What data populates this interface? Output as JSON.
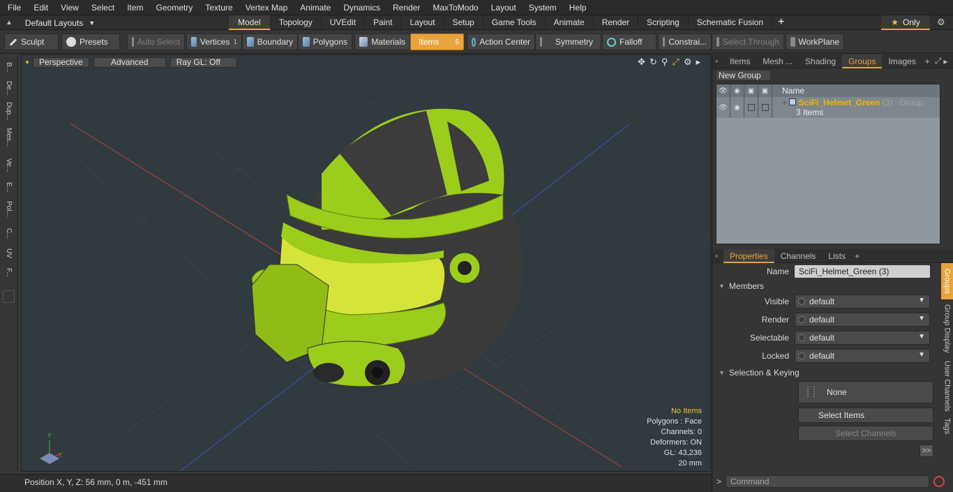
{
  "menu": [
    "File",
    "Edit",
    "View",
    "Select",
    "Item",
    "Geometry",
    "Texture",
    "Vertex Map",
    "Animate",
    "Dynamics",
    "Render",
    "MaxToModo",
    "Layout",
    "System",
    "Help"
  ],
  "layouts_label": "Default Layouts",
  "tabs": [
    "Model",
    "Topology",
    "UVEdit",
    "Paint",
    "Layout",
    "Setup",
    "Game Tools",
    "Animate",
    "Render",
    "Scripting",
    "Schematic Fusion"
  ],
  "only_label": "Only",
  "toolbar": {
    "sculpt": "Sculpt",
    "presets": "Presets",
    "auto_select": "Auto Select",
    "vertices": "Vertices",
    "vertices_count": "1",
    "boundary": "Boundary",
    "polygons": "Polygons",
    "materials": "Materials",
    "items": "Items",
    "items_count": "5",
    "action_center": "Action Center",
    "symmetry": "Symmetry",
    "falloff": "Falloff",
    "constraints": "Constrai...",
    "select_through": "Select Through",
    "workplane": "WorkPlane"
  },
  "left_tabs": [
    "B...",
    "De...",
    "Dup...",
    "Mes...",
    "Ve...",
    "E...",
    "Pol...",
    "C...",
    "UV",
    "F..."
  ],
  "viewport": {
    "perspective": "Perspective",
    "advanced": "Advanced",
    "raygl": "Ray GL: Off",
    "stats": {
      "no_items": "No Items",
      "polygons": "Polygons : Face",
      "channels": "Channels: 0",
      "deformers": "Deformers: ON",
      "gl": "GL: 43,236",
      "scale": "20 mm"
    }
  },
  "status": "Position X, Y, Z:  56 mm, 0 m, -451 mm",
  "right_tabs": [
    "Items",
    "Mesh ...",
    "Shading",
    "Groups",
    "Images"
  ],
  "groups": {
    "new_group": "New Group",
    "name_header": "Name",
    "group_name": "SciFi_Helmet_Green",
    "group_count": "(3)",
    "group_type": ": Group",
    "group_items": "3 Items"
  },
  "props_tabs": [
    "Properties",
    "Channels",
    "Lists"
  ],
  "props": {
    "name_label": "Name",
    "name_value": "SciFi_Helmet_Green (3)",
    "members": "Members",
    "visible_label": "Visible",
    "visible_value": "default",
    "render_label": "Render",
    "render_value": "default",
    "selectable_label": "Selectable",
    "selectable_value": "default",
    "locked_label": "Locked",
    "locked_value": "default",
    "selection_keying": "Selection & Keying",
    "none": "None",
    "select_items": "Select Items",
    "select_channels": "Select Channels",
    "more": ">>"
  },
  "vertical_tabs": [
    "Groups",
    "Group Display",
    "User Channels",
    "Tags"
  ],
  "command_placeholder": "Command",
  "colors": {
    "accent": "#e8a33b",
    "helmet_green": "#9ccc1c",
    "helmet_dark": "#3a3a3a",
    "viewport_bg": "#313a3f",
    "group_name": "#f5b400"
  }
}
